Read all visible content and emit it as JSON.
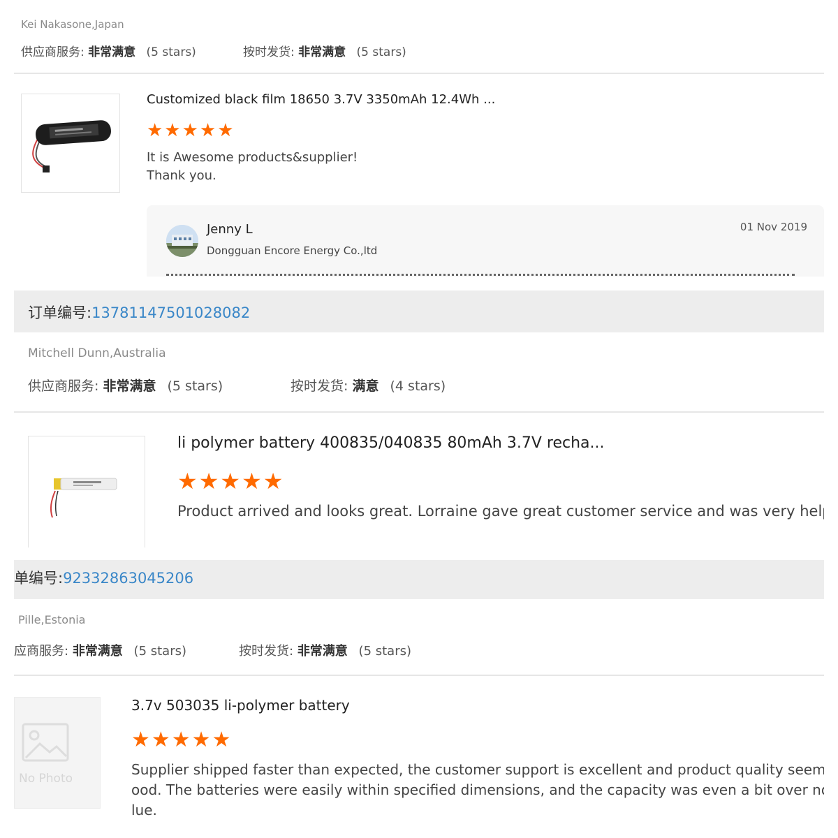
{
  "reviews": [
    {
      "reviewer": "Kei Nakasone,Japan",
      "supplier_service": {
        "label": "供应商服务:",
        "value": "非常满意",
        "stars_text": "(5 stars)"
      },
      "on_time_delivery": {
        "label": "按时发货:",
        "value": "非常满意",
        "stars_text": "(5 stars)"
      },
      "product_title": "Customized black film 18650 3.7V 3350mAh 12.4Wh ...",
      "rating_stars": 5,
      "stars_glyph": "★★★★★",
      "comment_line1": "It is Awesome products&supplier!",
      "comment_line2": "Thank you.",
      "reply": {
        "name": "Jenny L",
        "company": "Dongguan Encore Energy Co.,ltd",
        "date": "01 Nov 2019"
      }
    },
    {
      "order_label": "订单编号:",
      "order_number": "13781147501028082",
      "reviewer": "Mitchell Dunn,Australia",
      "supplier_service": {
        "label": "供应商服务:",
        "value": "非常满意",
        "stars_text": "(5 stars)"
      },
      "on_time_delivery": {
        "label": "按时发货:",
        "value": "满意",
        "stars_text": "(4 stars)"
      },
      "product_title": "li polymer battery 400835/040835 80mAh 3.7V recha...",
      "rating_stars": 5,
      "stars_glyph": "★★★★★",
      "comment": "Product arrived and looks great. Lorraine gave great customer service and was very helpful."
    },
    {
      "order_label": "单编号:",
      "order_number": "92332863045206",
      "reviewer": "Pille,Estonia",
      "supplier_service": {
        "label": "应商服务:",
        "value": "非常满意",
        "stars_text": "(5 stars)"
      },
      "on_time_delivery": {
        "label": "按时发货:",
        "value": "非常满意",
        "stars_text": "(5 stars)"
      },
      "product_title": "3.7v 503035 li-polymer battery",
      "no_photo_text": "No Photo",
      "rating_stars": 5,
      "stars_glyph": "★★★★★",
      "comment_line1": "Supplier shipped faster than expected, the customer support is excellent and product quality seems ver",
      "comment_line2": "ood. The batteries were easily within specified dimensions, and the capacity was even a bit over nomina",
      "comment_line3": "lue."
    }
  ],
  "colors": {
    "star": "#ff6a00",
    "order_number": "#3a87c8",
    "order_bar_bg": "#ededed",
    "divider": "#e6e6e6"
  }
}
